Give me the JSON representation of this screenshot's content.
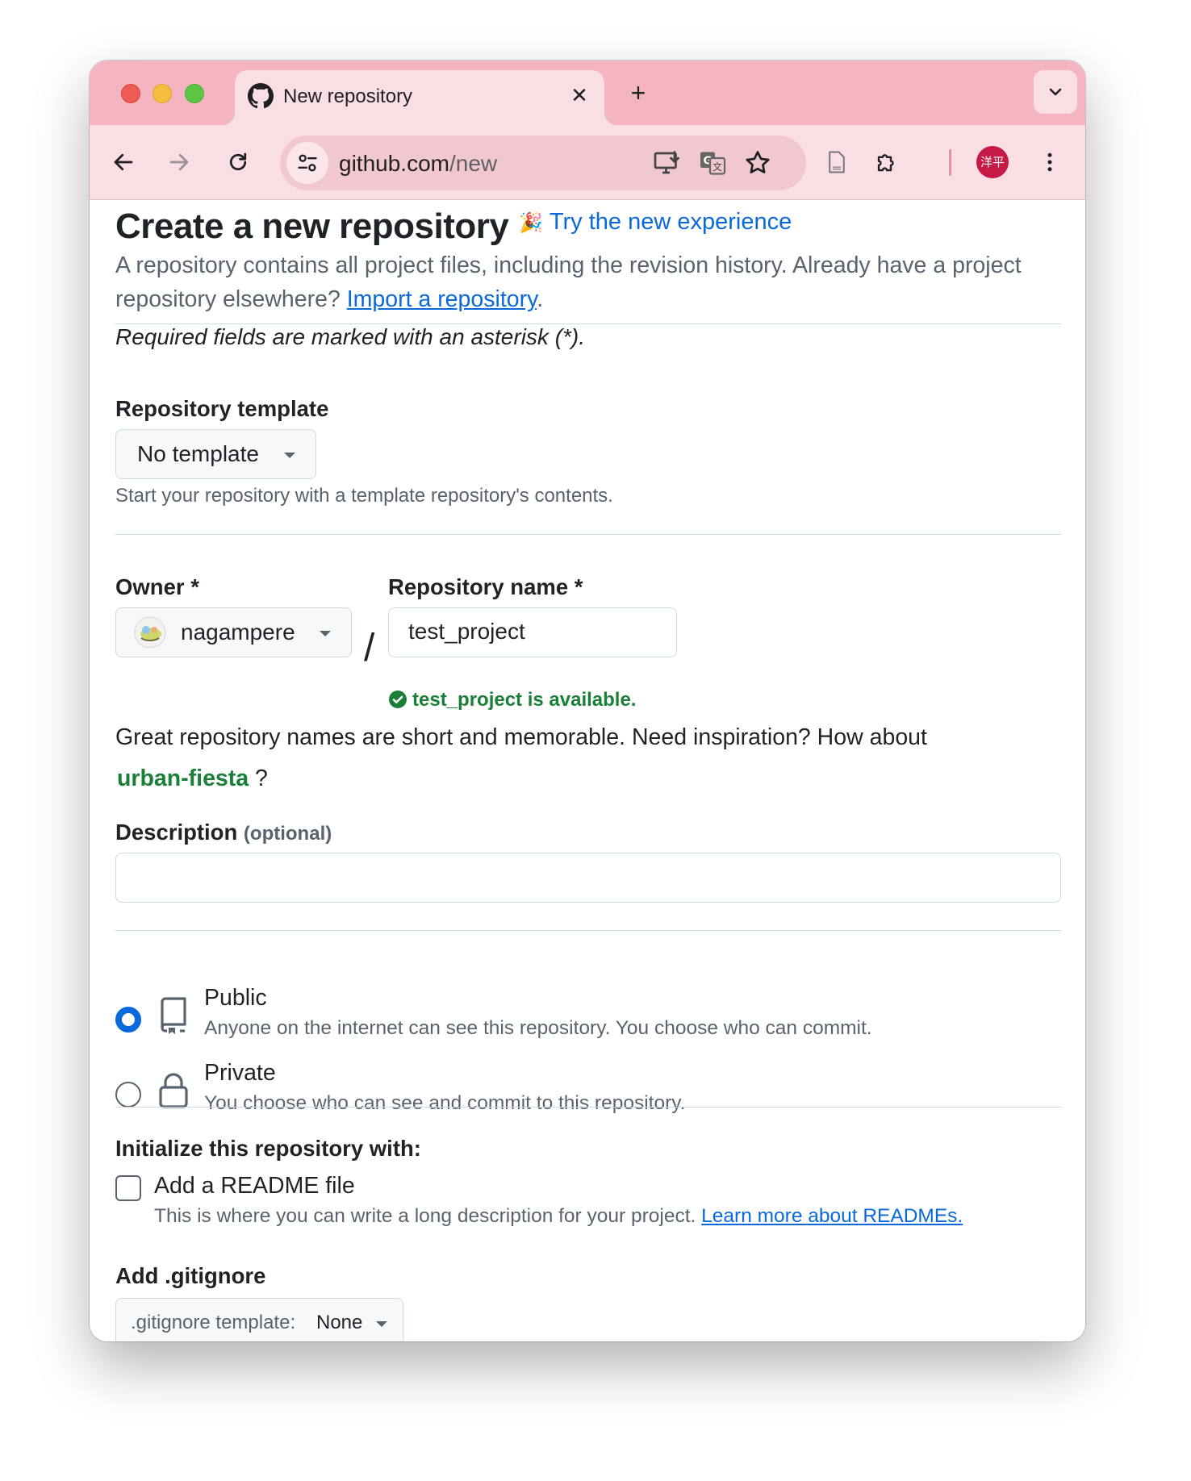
{
  "browser": {
    "tab_title": "New repository",
    "url_host": "github.com",
    "url_path": "/new",
    "profile_initials": "洋平",
    "accent_color": "#f4b5c1"
  },
  "page": {
    "heading": "Create a new repository",
    "try_new_experience": "Try the new experience",
    "intro_text": "A repository contains all project files, including the revision history. Already have a project repository elsewhere?",
    "import_link": "Import a repository",
    "required_note": "Required fields are marked with an asterisk (*).",
    "template": {
      "label": "Repository template",
      "selected": "No template",
      "helper": "Start your repository with a template repository's contents."
    },
    "owner": {
      "label": "Owner *",
      "selected": "nagampere"
    },
    "slash": "/",
    "repo_name": {
      "label": "Repository name *",
      "value": "test_project",
      "availability": "test_project is available."
    },
    "name_hint": "Great repository names are short and memorable. Need inspiration? How about",
    "suggestion": "urban-fiesta",
    "suggestion_suffix": "?",
    "description": {
      "label": "Description",
      "optional": "(optional)",
      "value": ""
    },
    "visibility": {
      "public_title": "Public",
      "public_desc": "Anyone on the internet can see this repository. You choose who can commit.",
      "private_title": "Private",
      "private_desc": "You choose who can see and commit to this repository.",
      "selected": "Public"
    },
    "initialize": {
      "label": "Initialize this repository with:",
      "readme_title": "Add a README file",
      "readme_desc": "This is where you can write a long description for your project.",
      "readme_link": "Learn more about READMEs.",
      "readme_checked": false
    },
    "gitignore": {
      "label": "Add .gitignore",
      "prefix": ".gitignore template:",
      "selected": "None"
    }
  }
}
